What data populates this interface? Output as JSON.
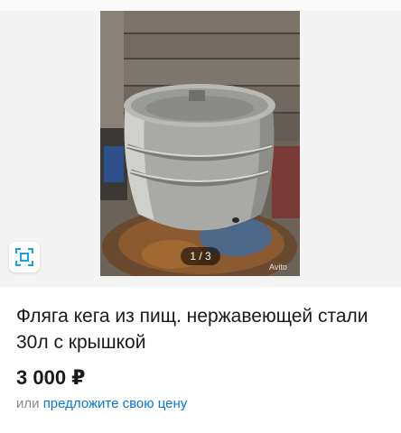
{
  "gallery": {
    "counter": "1 / 3",
    "watermark": "Avito",
    "expand_icon": "fullscreen-icon"
  },
  "listing": {
    "title": "Фляга кега из пищ. нержавеющей стали 30л с крышкой",
    "price": "3 000 ₽",
    "offer_prefix": "или",
    "offer_link": "предложите свою цену"
  },
  "colors": {
    "link": "#0a75d6",
    "text": "#1a1a1a",
    "muted": "#8a8a8a"
  }
}
